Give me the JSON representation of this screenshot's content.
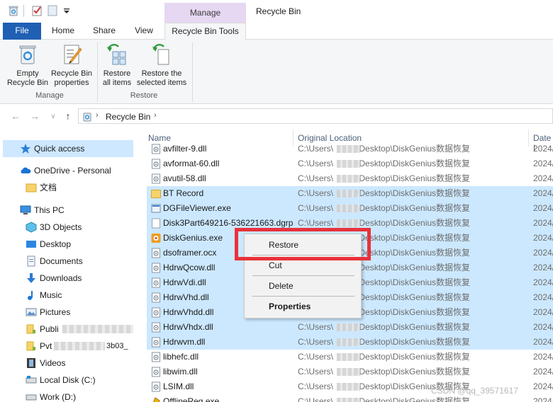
{
  "window": {
    "title": "Recycle Bin"
  },
  "ribbon": {
    "context_tab": "Manage",
    "tabs": [
      "File",
      "Home",
      "Share",
      "View",
      "Recycle Bin Tools"
    ],
    "buttons": {
      "empty": [
        "Empty",
        "Recycle Bin"
      ],
      "properties": [
        "Recycle Bin",
        "properties"
      ],
      "restore_all": [
        "Restore",
        "all items"
      ],
      "restore_selected": [
        "Restore the",
        "selected items"
      ]
    },
    "groups": {
      "manage": "Manage",
      "restore": "Restore"
    }
  },
  "address": {
    "path": "Recycle Bin"
  },
  "nav": {
    "quick_access": "Quick access",
    "onedrive": "OneDrive - Personal",
    "docs": "文档",
    "this_pc": "This PC",
    "objects3d": "3D Objects",
    "desktop": "Desktop",
    "documents": "Documents",
    "downloads": "Downloads",
    "music": "Music",
    "pictures": "Pictures",
    "public": "Publi",
    "pvt": "Pvt",
    "pvt_tail": "3b03_",
    "videos": "Videos",
    "local_disk": "Local Disk (C:)",
    "work": "Work (D:)"
  },
  "columns": {
    "name": "Name",
    "location": "Original Location",
    "date": "Date I"
  },
  "files": [
    {
      "name": "avfilter-9.dll",
      "loc_a": "C:\\Users\\",
      "loc_b": "\\Desktop\\DiskGenius数据恢复",
      "date": "2024/",
      "icon": "dll",
      "sel": false
    },
    {
      "name": "avformat-60.dll",
      "loc_a": "C:\\Users\\",
      "loc_b": "\\Desktop\\DiskGenius数据恢复",
      "date": "2024/",
      "icon": "dll",
      "sel": false
    },
    {
      "name": "avutil-58.dll",
      "loc_a": "C:\\Users\\",
      "loc_b": "\\Desktop\\DiskGenius数据恢复",
      "date": "2024/",
      "icon": "dll",
      "sel": false
    },
    {
      "name": "BT Record",
      "loc_a": "C:\\Users\\",
      "loc_b": "\\Desktop\\DiskGenius数据恢复",
      "date": "2024/",
      "icon": "folder",
      "sel": true
    },
    {
      "name": "DGFileViewer.exe",
      "loc_a": "C:\\Users\\",
      "loc_b": "\\Desktop\\DiskGenius数据恢复",
      "date": "2024/",
      "icon": "exe",
      "sel": true
    },
    {
      "name": "Disk3Part649216-536221663.dgrp",
      "loc_a": "C:\\Users\\",
      "loc_b": "\\Desktop\\DiskGenius数据恢复",
      "date": "2024/",
      "icon": "blank",
      "sel": true
    },
    {
      "name": "DiskGenius.exe",
      "loc_a": "C:\\Users\\",
      "loc_b": "\\Desktop\\DiskGenius数据恢复",
      "date": "2024/",
      "icon": "dg",
      "sel": true
    },
    {
      "name": "dsoframer.ocx",
      "loc_a": "C:\\Users\\",
      "loc_b": "\\Desktop\\DiskGenius数据恢复",
      "date": "2024/",
      "icon": "dll",
      "sel": true
    },
    {
      "name": "HdrwQcow.dll",
      "loc_a": "C:\\Users\\",
      "loc_b": "\\Desktop\\DiskGenius数据恢复",
      "date": "2024/",
      "icon": "dll",
      "sel": true
    },
    {
      "name": "HdrwVdi.dll",
      "loc_a": "C:\\Users\\",
      "loc_b": "\\Desktop\\DiskGenius数据恢复",
      "date": "2024/",
      "icon": "dll",
      "sel": true
    },
    {
      "name": "HdrwVhd.dll",
      "loc_a": "C:\\Users\\",
      "loc_b": "\\Desktop\\DiskGenius数据恢复",
      "date": "2024/",
      "icon": "dll",
      "sel": true
    },
    {
      "name": "HdrwVhdd.dll",
      "loc_a": "C:\\Users\\",
      "loc_b": "\\Desktop\\DiskGenius数据恢复",
      "date": "2024/",
      "icon": "dll",
      "sel": true
    },
    {
      "name": "HdrwVhdx.dll",
      "loc_a": "C:\\Users\\",
      "loc_b": "\\Desktop\\DiskGenius数据恢复",
      "date": "2024/",
      "icon": "dll",
      "sel": true
    },
    {
      "name": "Hdrwvm.dll",
      "loc_a": "C:\\Users\\",
      "loc_b": "\\Desktop\\DiskGenius数据恢复",
      "date": "2024/",
      "icon": "dll",
      "sel": true
    },
    {
      "name": "libhefc.dll",
      "loc_a": "C:\\Users\\",
      "loc_b": "\\Desktop\\DiskGenius数据恢复",
      "date": "2024/",
      "icon": "dll",
      "sel": false
    },
    {
      "name": "libwim.dll",
      "loc_a": "C:\\Users\\",
      "loc_b": "\\Desktop\\DiskGenius数据恢复",
      "date": "2024/",
      "icon": "dll",
      "sel": false
    },
    {
      "name": "LSIM.dll",
      "loc_a": "C:\\Users\\",
      "loc_b": "\\Desktop\\DiskGenius数据恢复",
      "date": "2024/",
      "icon": "dll",
      "sel": false
    },
    {
      "name": "OfflineReg.exe",
      "loc_a": "C:\\Users\\",
      "loc_b": "\\Desktop\\DiskGenius数据恢复",
      "date": "2024/",
      "icon": "exe2",
      "sel": false
    }
  ],
  "context_menu": {
    "restore": "Restore",
    "cut": "Cut",
    "delete": "Delete",
    "properties": "Properties"
  },
  "watermark": "CSDN @qq_39571617",
  "colors": {
    "accent": "#1f5fb4",
    "selection": "#cce8ff",
    "highlight": "#e8323b",
    "context_tab": "#e6d7f2"
  }
}
